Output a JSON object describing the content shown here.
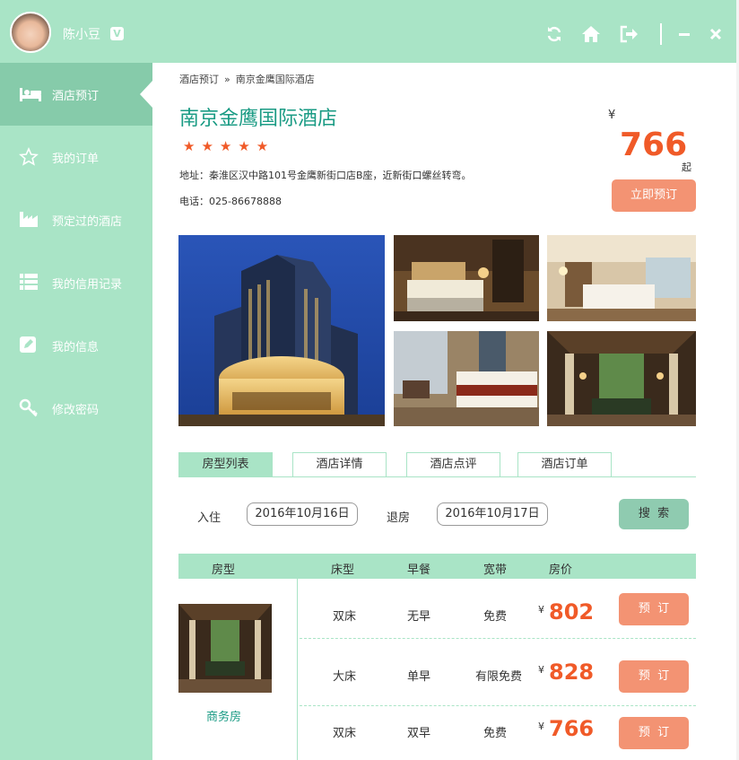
{
  "user": {
    "name": "陈小豆",
    "badge": "V"
  },
  "sidebar": {
    "items": [
      {
        "label": "酒店预订",
        "icon": "bed-icon",
        "active": true
      },
      {
        "label": "我的订单",
        "icon": "star-icon",
        "active": false
      },
      {
        "label": "预定过的酒店",
        "icon": "factory-icon",
        "active": false
      },
      {
        "label": "我的信用记录",
        "icon": "list-icon",
        "active": false
      },
      {
        "label": "我的信息",
        "icon": "edit-icon",
        "active": false
      },
      {
        "label": "修改密码",
        "icon": "key-icon",
        "active": false
      }
    ]
  },
  "toolbar": {
    "icons": [
      "refresh-icon",
      "home-icon",
      "logout-icon",
      "minimize-icon",
      "close-icon"
    ]
  },
  "breadcrumb": {
    "parent": "酒店预订",
    "separator": "»",
    "current": "南京金鹰国际酒店"
  },
  "hotel": {
    "name": "南京金鹰国际酒店",
    "rating_stars": 5,
    "stars_text": "★★★★★",
    "address": "地址：秦淮区汉中路101号金鹰新街口店B座，近新街口螺丝转弯。",
    "phone": "电话：025-86678888",
    "currency": "¥",
    "price_from": "766",
    "price_suffix": "起",
    "book_label": "立即预订"
  },
  "tabs": [
    {
      "label": "房型列表",
      "active": true
    },
    {
      "label": "酒店详情",
      "active": false
    },
    {
      "label": "酒店点评",
      "active": false
    },
    {
      "label": "酒店订单",
      "active": false
    }
  ],
  "search": {
    "checkin_label": "入住",
    "checkin_value": "2016年10月16日",
    "checkout_label": "退房",
    "checkout_value": "2016年10月17日",
    "button_label": "搜  索"
  },
  "table": {
    "headers": [
      "房型",
      "床型",
      "早餐",
      "宽带",
      "房价"
    ],
    "room_type": "商务房",
    "rows": [
      {
        "bed": "双床",
        "breakfast": "无早",
        "wifi": "免费",
        "currency": "¥",
        "price": "802",
        "button": "预  订"
      },
      {
        "bed": "大床",
        "breakfast": "单早",
        "wifi": "有限免费",
        "currency": "¥",
        "price": "828",
        "button": "预  订"
      },
      {
        "bed": "双床",
        "breakfast": "双早",
        "wifi": "免费",
        "currency": "¥",
        "price": "766",
        "button": "预  订"
      }
    ]
  },
  "colors": {
    "accent": "#a9e4c6",
    "accent_dark": "#86cbaa",
    "brand_text": "#1a9b84",
    "price": "#f05a28",
    "button": "#f39373"
  }
}
